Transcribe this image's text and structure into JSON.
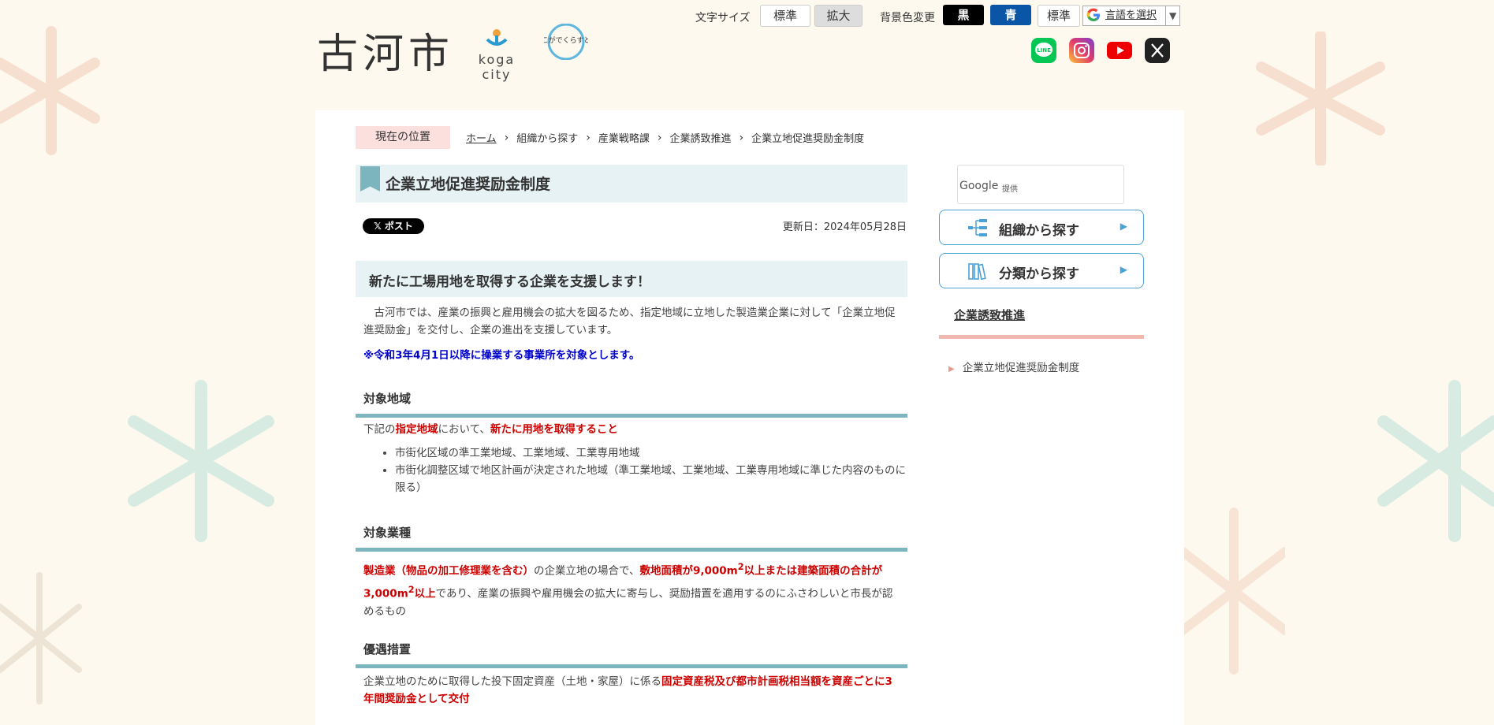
{
  "header": {
    "logo_main": "古河市",
    "logo_sub": "koga city",
    "logo_kogakurasu": "こがでくらすと",
    "font_size_label": "文字サイズ",
    "font_size_standard": "標準",
    "font_size_large": "拡大",
    "bg_color_label": "背景色変更",
    "bg_black": "黒",
    "bg_blue": "青",
    "bg_standard": "標準",
    "language_select": "言語を選択",
    "language_arrow": "▼",
    "sns": [
      "line-icon",
      "instagram-icon",
      "youtube-icon",
      "x-icon"
    ],
    "sns_labels": {
      "line": "LINE"
    }
  },
  "breadcrumb": {
    "current_label": "現在の位置",
    "items": [
      "ホーム",
      "組織から探す",
      "産業戦略課",
      "企業誘致推進",
      "企業立地促進奨励金制度"
    ]
  },
  "page": {
    "title": "企業立地促進奨励金制度",
    "x_post": "ポスト",
    "updated": "更新日：2024年05月28日",
    "section_title": "新たに工場用地を取得する企業を支援します！",
    "intro": "　古河市では、産業の振興と雇用機会の拡大を図るため、指定地域に立地した製造業企業に対して「企業立地促進奨励金」を交付し、企業の進出を支援しています。",
    "note": "※令和3年4月1日以降に操業する事業所を対象とします。",
    "area": {
      "heading": "対象地域",
      "lead_1": "下記の",
      "lead_red_1": "指定地域",
      "lead_2": "において、",
      "lead_red_2": "新たに用地を取得すること",
      "bullets": [
        "市街化区域の準工業地域、工業地域、工業専用地域",
        "市街化調整区域で地区計画が決定された地域（準工業地域、工業地域、工業専用地域に準じた内容のものに限る）"
      ]
    },
    "industry": {
      "heading": "対象業種",
      "red_1": "製造業（物品の加工修理業を含む）",
      "text_1": "の企業立地の場合で、",
      "red_2a": "敷地面積が9,000m",
      "sup": "2",
      "red_2b": "以上または建築面積の合計が3,000m",
      "red_2c": "以上",
      "text_2": "であり、産業の振興や雇用機会の拡大に寄与し、奨励措置を適用するのにふさわしいと市長が認めるもの"
    },
    "benefit": {
      "heading": "優遇措置",
      "text_1": "企業立地のために取得した投下固定資産（土地・家屋）に係る",
      "red_1": "固定資産税及び都市計画税相当額を資産ごとに3年間奨励金として交付"
    }
  },
  "sidebar": {
    "search_brand": "Google",
    "search_provided": "提供",
    "btn_org": "組織から探す",
    "btn_category": "分類から探す",
    "section_title": "企業誘致推進",
    "links": [
      "企業立地促進奨励金制度"
    ]
  },
  "colors": {
    "accent_teal": "#7db5bf",
    "heading_bg": "#e6f2f4",
    "breadcrumb_bg": "#fbe0de",
    "side_line": "#f0b8ae",
    "button_border": "#4aa1d6",
    "red_text": "#cc0000",
    "blue_text": "#0000cc"
  }
}
